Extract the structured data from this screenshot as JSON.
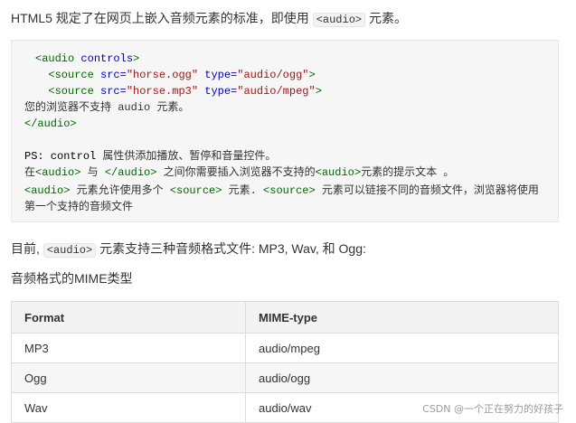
{
  "intro": {
    "before": "HTML5 规定了在网页上嵌入音频元素的标准，即使用 ",
    "code": "<audio>",
    "after": " 元素。"
  },
  "code_block": {
    "line1_tag_open": "<audio",
    "line1_attr": " controls",
    "line1_tag_close": ">",
    "line2_tag": "  <source",
    "line2_src_attr": " src=",
    "line2_src_val": "\"horse.ogg\"",
    "line2_type_attr": " type=",
    "line2_type_val": "\"audio/ogg\"",
    "line2_end": ">",
    "line3_tag": "  <source",
    "line3_src_attr": " src=",
    "line3_src_val": "\"horse.mp3\"",
    "line3_type_attr": " type=",
    "line3_type_val": "\"audio/mpeg\"",
    "line3_end": ">",
    "line4": "您的浏览器不支持 audio 元素。",
    "line5": "</audio>",
    "ps_label": "PS:",
    "ps_code": " control",
    "ps_text": " 属性供添加播放、暂停和音量控件。",
    "n1_a": "在",
    "n1_tag1": "<audio>",
    "n1_b": " 与 ",
    "n1_tag2": "</audio>",
    "n1_c": " 之间你需要插入浏览器不支持的",
    "n1_tag3": "<audio>",
    "n1_d": "元素的提示文本 。",
    "n2_tag1": "<audio>",
    "n2_a": " 元素允许使用多个 ",
    "n2_tag2": "<source>",
    "n2_b": " 元素. ",
    "n2_tag3": "<source>",
    "n2_c": " 元素可以链接不同的音频文件，浏览器将使用",
    "n3": "第一个支持的音频文件"
  },
  "formats_para": {
    "before": "目前, ",
    "code": "<audio>",
    "after": " 元素支持三种音频格式文件: MP3, Wav, 和 Ogg:"
  },
  "mime_heading": "音频格式的MIME类型",
  "table": {
    "headers": [
      "Format",
      "MIME-type"
    ],
    "rows": [
      [
        "MP3",
        "audio/mpeg"
      ],
      [
        "Ogg",
        "audio/ogg"
      ],
      [
        "Wav",
        "audio/wav"
      ]
    ]
  },
  "watermark": "CSDN @一个正在努力的好孩子"
}
